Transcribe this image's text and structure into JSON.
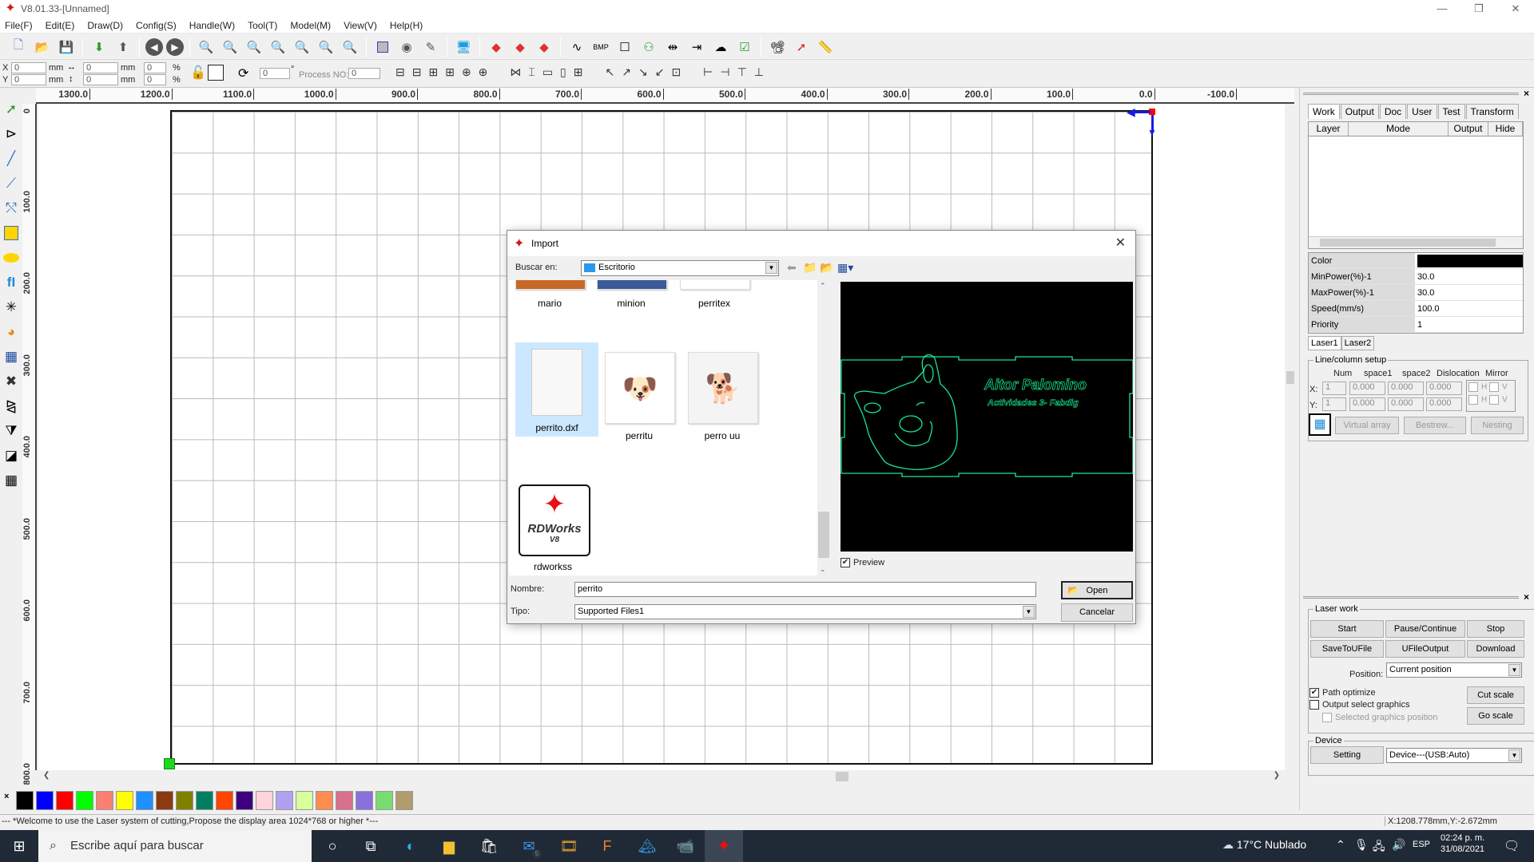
{
  "window": {
    "title": "V8.01.33-[Unnamed]",
    "minimize": "—",
    "restore": "❐",
    "close": "✕"
  },
  "menu": [
    "File(F)",
    "Edit(E)",
    "Draw(D)",
    "Config(S)",
    "Handle(W)",
    "Tool(T)",
    "Model(M)",
    "View(V)",
    "Help(H)"
  ],
  "toolbar2": {
    "x_label": "X",
    "y_label": "Y",
    "x_value": "0",
    "y_value": "0",
    "w_value": "0",
    "h_value": "0",
    "unit_mm": "mm",
    "scale_x": "0",
    "scale_y": "0",
    "unit_pct": "%",
    "rotate_value": "0",
    "degree": "°",
    "process_no_label": "Process NO:",
    "process_no_value": "0"
  },
  "ruler": {
    "h_ticks": [
      "1300.0",
      "1200.0",
      "1100.0",
      "1000.0",
      "900.0",
      "800.0",
      "700.0",
      "600.0",
      "500.0",
      "400.0",
      "300.0",
      "200.0",
      "100.0",
      "0.0",
      "-100.0"
    ],
    "v_ticks": [
      "0",
      "100.0",
      "200.0",
      "300.0",
      "400.0",
      "500.0",
      "600.0",
      "700.0",
      "800.0"
    ]
  },
  "palette": [
    "#000000",
    "#0000ff",
    "#ff0000",
    "#00ff00",
    "#fa8072",
    "#ffff00",
    "#1e90ff",
    "#8b3a12",
    "#808000",
    "#008060",
    "#ff4500",
    "#3f007f",
    "#ffd4dc",
    "#b0a0f0",
    "#d8ff9c",
    "#ff8c50",
    "#d87090",
    "#8a70dc",
    "#78dc70",
    "#b09c70"
  ],
  "status": {
    "message": "--- *Welcome to use the Laser system of cutting,Propose the display area 1024*768 or higher *---",
    "coords": "X:1208.778mm,Y:-2.672mm"
  },
  "right_panel": {
    "tabs": [
      "Work",
      "Output",
      "Doc",
      "User",
      "Test",
      "Transform"
    ],
    "active_tab": "Work",
    "layer_columns": [
      "Layer",
      "Mode",
      "Output",
      "Hide"
    ],
    "props": [
      {
        "key": "Color",
        "value": ""
      },
      {
        "key": "MinPower(%)-1",
        "value": "30.0"
      },
      {
        "key": "MaxPower(%)-1",
        "value": "30.0"
      },
      {
        "key": "Speed(mm/s)",
        "value": "100.0"
      },
      {
        "key": "Priority",
        "value": "1"
      }
    ],
    "color_value": "#000000",
    "laser_tabs": [
      "Laser1",
      "Laser2"
    ],
    "line_column": {
      "legend": "Line/column setup",
      "headers": [
        "Num",
        "space1",
        "space2",
        "Dislocation",
        "Mirror"
      ],
      "x_label": "X:",
      "y_label": "Y:",
      "x_values": [
        "1",
        "0.000",
        "0.000",
        "0.000"
      ],
      "y_values": [
        "1",
        "0.000",
        "0.000",
        "0.000"
      ],
      "mirror_h": "H",
      "mirror_v": "V",
      "virtual_array": "Virtual array",
      "bestrew": "Bestrew...",
      "nesting": "Nesting"
    },
    "laser_work": {
      "legend": "Laser work",
      "start": "Start",
      "pause": "Pause/Continue",
      "stop": "Stop",
      "save_ufile": "SaveToUFile",
      "ufile_output": "UFileOutput",
      "download": "Download",
      "position_label": "Position:",
      "position_value": "Current position",
      "path_optimize": "Path optimize",
      "path_optimize_checked": true,
      "output_select": "Output select graphics",
      "selected_pos": "Selected graphics position",
      "cut_scale": "Cut scale",
      "go_scale": "Go scale"
    },
    "device": {
      "legend": "Device",
      "setting": "Setting",
      "value": "Device---(USB:Auto)"
    }
  },
  "dialog": {
    "title": "Import",
    "look_in_label": "Buscar en:",
    "look_in_value": "Escritorio",
    "files": [
      {
        "name": "mario"
      },
      {
        "name": "minion"
      },
      {
        "name": "perritex"
      },
      {
        "name": "perrito.dxf",
        "selected": true
      },
      {
        "name": "perritu"
      },
      {
        "name": "perro uu"
      },
      {
        "name": "rdworkss"
      }
    ],
    "rdworks_logo": "RDWorks",
    "rdworks_ver": "V8",
    "preview_label": "Preview",
    "preview_checked": true,
    "preview_text1": "Aitor Palomino",
    "preview_text2": "Actividades 3- Fabdig",
    "name_label": "Nombre:",
    "name_value": "perrito",
    "type_label": "Tipo:",
    "type_value": "Supported Files1",
    "open": "Open",
    "cancel": "Cancelar"
  },
  "taskbar": {
    "search_placeholder": "Escribe aquí para buscar",
    "weather": "17°C  Nublado",
    "lang": "ESP",
    "time": "02:24 p. m.",
    "date": "31/08/2021",
    "mail_badge": "5"
  }
}
